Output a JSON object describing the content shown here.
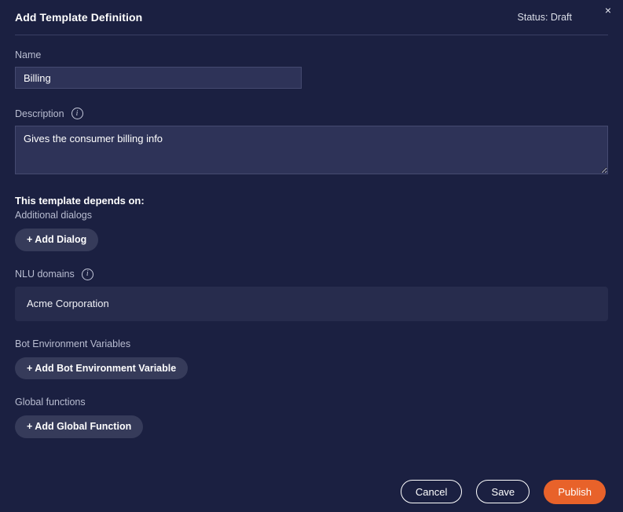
{
  "header": {
    "title": "Add Template Definition",
    "status": "Status: Draft",
    "close_label": "×"
  },
  "form": {
    "name": {
      "label": "Name",
      "value": "Billing",
      "placeholder": ""
    },
    "description": {
      "label": "Description",
      "info_glyph": "i",
      "value": "Gives the consumer billing info",
      "placeholder": ""
    }
  },
  "dependencies": {
    "heading": "This template depends on:",
    "additional_dialogs": {
      "label": "Additional dialogs",
      "add_button": "+ Add Dialog"
    },
    "nlu_domains": {
      "label": "NLU domains",
      "info_glyph": "i",
      "value": "Acme Corporation"
    },
    "bot_environment_variables": {
      "label": "Bot Environment Variables",
      "add_button": "+ Add Bot Environment Variable"
    },
    "global_functions": {
      "label": "Global functions",
      "add_button": "+ Add Global Function"
    }
  },
  "footer": {
    "cancel_label": "Cancel",
    "save_label": "Save",
    "publish_label": "Publish"
  },
  "colors": {
    "background": "#1b2041",
    "field_background": "#2e3358",
    "panel_background": "#272c4d",
    "pill_background": "#363b5a",
    "accent_publish": "#e8622a",
    "label_text": "#b9bdd1"
  }
}
